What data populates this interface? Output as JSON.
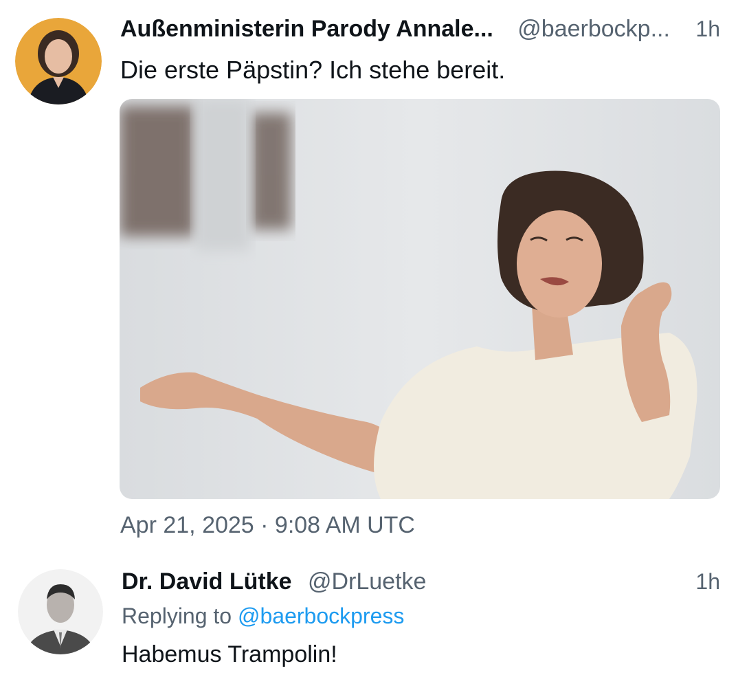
{
  "main_tweet": {
    "display_name": "Außenministerin Parody Annale...",
    "handle": "@baerbockp...",
    "time_ago": "1h",
    "text": "Die erste Päpstin? Ich stehe bereit.",
    "timestamp": "Apr 21, 2025 · 9:08 AM UTC",
    "avatar_icon": "profile-photo-woman",
    "media_icon": "photo-woman-gesturing"
  },
  "reply_tweet": {
    "display_name": "Dr. David Lütke",
    "handle": "@DrLuetke",
    "time_ago": "1h",
    "replying_prefix": "Replying to",
    "replying_handle": "@baerbockpress",
    "text": "Habemus Trampolin!",
    "avatar_icon": "profile-photo-man"
  },
  "colors": {
    "text_primary": "#0f1419",
    "text_secondary": "#566370",
    "link": "#1d9bf0",
    "avatar_bg_yellow": "#e9a63a"
  }
}
